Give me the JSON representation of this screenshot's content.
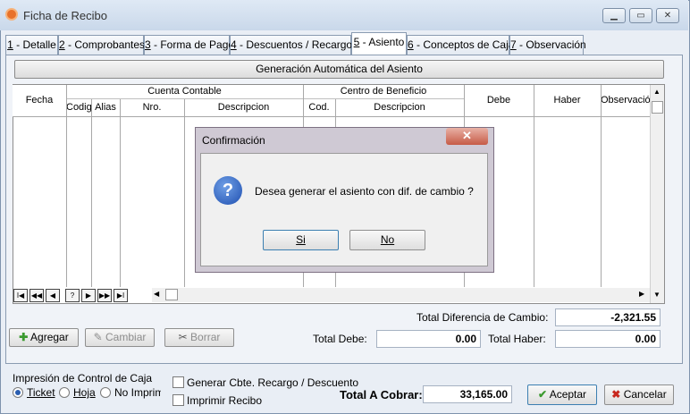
{
  "window": {
    "title": "Ficha de Recibo",
    "min": "▁",
    "max": "▭",
    "close": "✕"
  },
  "tabs": [
    {
      "key": "1",
      "label": " - Detalle"
    },
    {
      "key": "2",
      "label": " - Comprobantes"
    },
    {
      "key": "3",
      "label": " - Forma de Pago"
    },
    {
      "key": "4",
      "label": " - Descuentos / Recargos"
    },
    {
      "key": "5",
      "label": " - Asiento"
    },
    {
      "key": "6",
      "label": " - Conceptos de Caja"
    },
    {
      "key": "7",
      "label": " - Observación"
    }
  ],
  "gen_button": "Generación Automática del Asiento",
  "grid": {
    "group_cuenta": "Cuenta Contable",
    "group_centro": "Centro de Beneficio",
    "col_fecha": "Fecha",
    "col_codigo": "Codigo",
    "col_alias": "Alias",
    "col_nro": "Nro.",
    "col_desc1": "Descripcion",
    "col_cod": "Cod.",
    "col_desc2": "Descripcion",
    "col_debe": "Debe",
    "col_haber": "Haber",
    "col_obs": "Observación"
  },
  "nav": [
    "I◀",
    "◀◀",
    "◀",
    "?",
    "▶",
    "▶▶",
    "▶I"
  ],
  "buttons": {
    "agregar": "Agregar",
    "cambiar": "Cambiar",
    "borrar": "Borrar",
    "aceptar": "Aceptar",
    "cancelar": "Cancelar"
  },
  "totals": {
    "dif_label": "Total Diferencia de Cambio:",
    "dif_value": "-2,321.55",
    "debe_label": "Total Debe:",
    "debe_value": "0.00",
    "haber_label": "Total Haber:",
    "haber_value": "0.00",
    "cobrar_label": "Total A Cobrar:",
    "cobrar_value": "33,165.00"
  },
  "impresion": {
    "title": "Impresión de Control de Caja",
    "options": [
      "Ticket",
      "Hoja",
      "No Imprimir"
    ],
    "selected": "Ticket"
  },
  "checks": {
    "generar": "Generar Cbte. Recargo / Descuento",
    "imprimir": "Imprimir Recibo"
  },
  "dialog": {
    "title": "Confirmación",
    "message": "Desea generar el asiento con dif. de cambio ?",
    "si": "Si",
    "no": "No",
    "close": "✕"
  }
}
